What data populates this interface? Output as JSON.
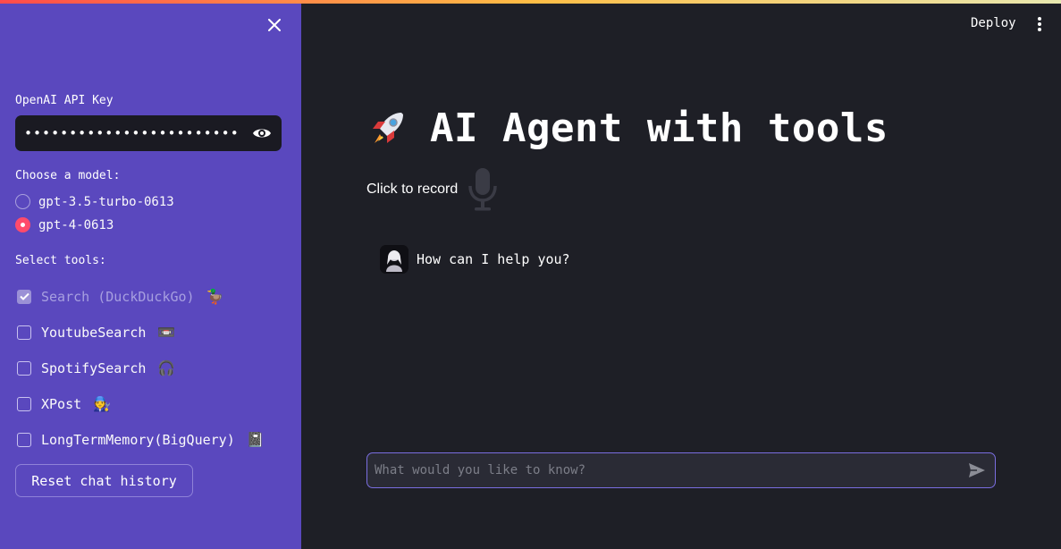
{
  "sidebar": {
    "api_key_label": "OpenAI API Key",
    "api_key_value": "••••••••••••••••••••••••",
    "model_label": "Choose a model:",
    "models": [
      {
        "label": "gpt-3.5-turbo-0613",
        "selected": false
      },
      {
        "label": "gpt-4-0613",
        "selected": true
      }
    ],
    "tools_label": "Select tools:",
    "tools": [
      {
        "label": "Search (DuckDuckGo)",
        "emoji": "🦆",
        "checked": true,
        "disabled": true
      },
      {
        "label": "YoutubeSearch",
        "emoji": "📼",
        "checked": false,
        "disabled": false
      },
      {
        "label": "SpotifySearch",
        "emoji": "🎧",
        "checked": false,
        "disabled": false
      },
      {
        "label": "XPost",
        "emoji": "🧑‍🔧",
        "checked": false,
        "disabled": false
      },
      {
        "label": "LongTermMemory(BigQuery)",
        "emoji": "📓",
        "checked": false,
        "disabled": false
      }
    ],
    "reset_label": "Reset chat history"
  },
  "header": {
    "deploy_label": "Deploy"
  },
  "main": {
    "title": "AI Agent with tools",
    "record_label": "Click to record",
    "messages": [
      {
        "role": "assistant",
        "text": "How can I help you?"
      }
    ],
    "input_placeholder": "What would you like to know?"
  },
  "colors": {
    "sidebar_bg": "#5a48be",
    "main_bg": "#1e1f26",
    "accent": "#ff4b6b"
  }
}
